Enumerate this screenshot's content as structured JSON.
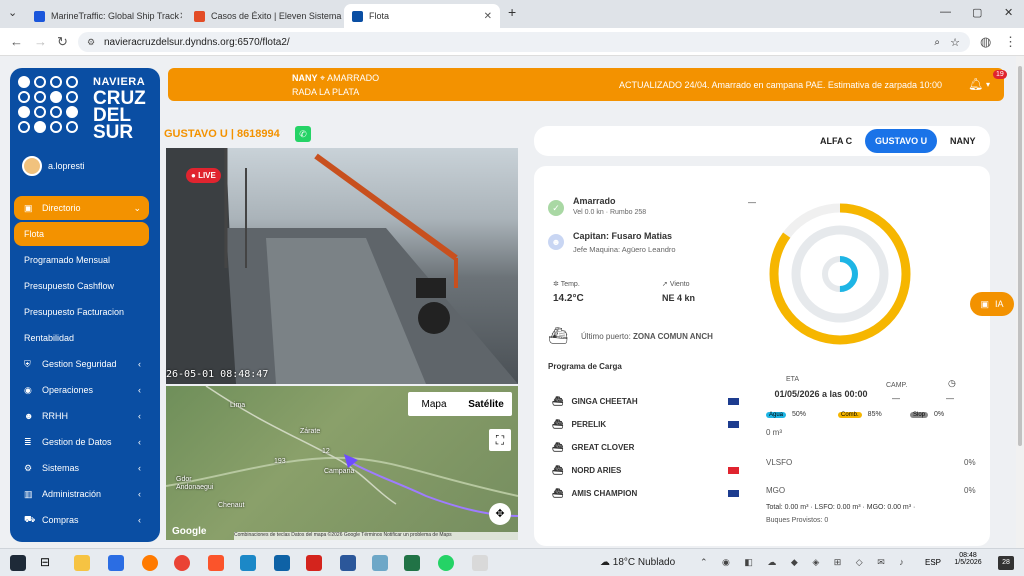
{
  "browser": {
    "tabs": [
      {
        "label": "MarineTraffic: Global Ship Track",
        "color": "#1a56db"
      },
      {
        "label": "Casos de Éxito | Eleven Sistema",
        "color": "#e34c26"
      },
      {
        "label": "Flota",
        "color": "#0a4ea3"
      }
    ],
    "url": "navieracruzdelsur.dyndns.org:6570/flota2/"
  },
  "sidebar": {
    "logo_small": "NAVIERA",
    "logo_big_1": "CRUZ",
    "logo_big_2": "DEL",
    "logo_big_3": "SUR",
    "user": "a.lopresti",
    "items": [
      {
        "label": "Directorio",
        "icon": "briefcase-icon",
        "glyph": "▣",
        "arrow": "⌄",
        "style": "orange"
      },
      {
        "label": "Flota",
        "icon": "",
        "glyph": "",
        "arrow": "",
        "style": "orange"
      },
      {
        "label": "Programado Mensual",
        "icon": "",
        "glyph": "",
        "arrow": "",
        "style": ""
      },
      {
        "label": "Presupuesto Cashflow",
        "icon": "",
        "glyph": "",
        "arrow": "",
        "style": ""
      },
      {
        "label": "Presupuesto Facturacion",
        "icon": "",
        "glyph": "",
        "arrow": "",
        "style": ""
      },
      {
        "label": "Rentabilidad",
        "icon": "",
        "glyph": "",
        "arrow": "",
        "style": ""
      },
      {
        "label": "Gestion Seguridad",
        "icon": "shield-icon",
        "glyph": "⛨",
        "arrow": "‹",
        "style": ""
      },
      {
        "label": "Operaciones",
        "icon": "globe-icon",
        "glyph": "◉",
        "arrow": "‹",
        "style": ""
      },
      {
        "label": "RRHH",
        "icon": "users-icon",
        "glyph": "☻",
        "arrow": "‹",
        "style": ""
      },
      {
        "label": "Gestion de Datos",
        "icon": "database-icon",
        "glyph": "≣",
        "arrow": "‹",
        "style": ""
      },
      {
        "label": "Sistemas",
        "icon": "gears-icon",
        "glyph": "⚙",
        "arrow": "‹",
        "style": ""
      },
      {
        "label": "Administración",
        "icon": "building-icon",
        "glyph": "▥",
        "arrow": "‹",
        "style": ""
      },
      {
        "label": "Compras",
        "icon": "cart-icon",
        "glyph": "⛟",
        "arrow": "‹",
        "style": ""
      }
    ]
  },
  "topbar": {
    "vessel": "NANY",
    "status": "AMARRADO",
    "location": "RADA LA PLATA",
    "update": "ACTUALIZADO 24/04. Amarrado en campana PAE. Estimativa de zarpada 10:00",
    "notifications": "19"
  },
  "vessel": {
    "title": "GUSTAVO U | 8618994",
    "live": "LIVE",
    "timestamp": "26-05-01 08:48:47"
  },
  "map": {
    "toggle_map": "Mapa",
    "toggle_sat": "Satélite",
    "labels": [
      "Lima",
      "Zárate",
      "Campana",
      "Gdor Andonaegui",
      "Chenaut",
      "193",
      "12"
    ],
    "footer": "Combinaciones de teclas  Datos del mapa ©2026 Google  Términos  Notificar un problema de Maps",
    "brand": "Google"
  },
  "vessel_tabs": [
    "ALFA C",
    "GUSTAVO U",
    "NANY"
  ],
  "status": {
    "state": "Amarrado",
    "speed": "Vel 0.0 kn · Rumbo 258",
    "dash": "—",
    "captain": "Capitan: Fusaro Matias",
    "engineer": "Jefe Maquina: Agüero Leandro",
    "temp_label": "Temp.",
    "temp": "14.2°C",
    "wind_label": "Viento",
    "wind": "NE 4 kn",
    "last_port": "Último puerto:",
    "last_port_value": "ZONA COMUN ANCH",
    "tanks": [
      {
        "label": "Agua",
        "value": "50%",
        "color": "#1eb5e5"
      },
      {
        "label": "Comb.",
        "value": "85%",
        "color": "#f6b600"
      },
      {
        "label": "Slop",
        "value": "0%",
        "color": "#888888"
      }
    ],
    "gauge": {
      "agua": 0.5,
      "comb": 0.85,
      "slop": 0
    }
  },
  "cargo": {
    "title": "Programa de Carga",
    "ships": [
      "GINGA CHEETAH",
      "PERELIK",
      "GREAT CLOVER",
      "NORD ARIES",
      "AMIS CHAMPION"
    ],
    "eta_label": "ETA",
    "eta_value": "01/05/2026 a las 00:00",
    "camp_label": "CAMP.",
    "dash": "—",
    "m3": "0 m³",
    "vlsfo": "VLSFO",
    "vlsfo_pct": "0%",
    "mgo": "MGO",
    "mgo_pct": "0%",
    "total": "Total: 0.00 m³ · LSFO: 0.00 m³ · MGO: 0.00 m³ ·",
    "buques": "Buques Provistos: 0"
  },
  "ia": "IA",
  "taskbar": {
    "weather": "18°C  Nublado",
    "lang": "ESP",
    "time": "08:48",
    "date": "1/5/2026",
    "badge": "28"
  }
}
